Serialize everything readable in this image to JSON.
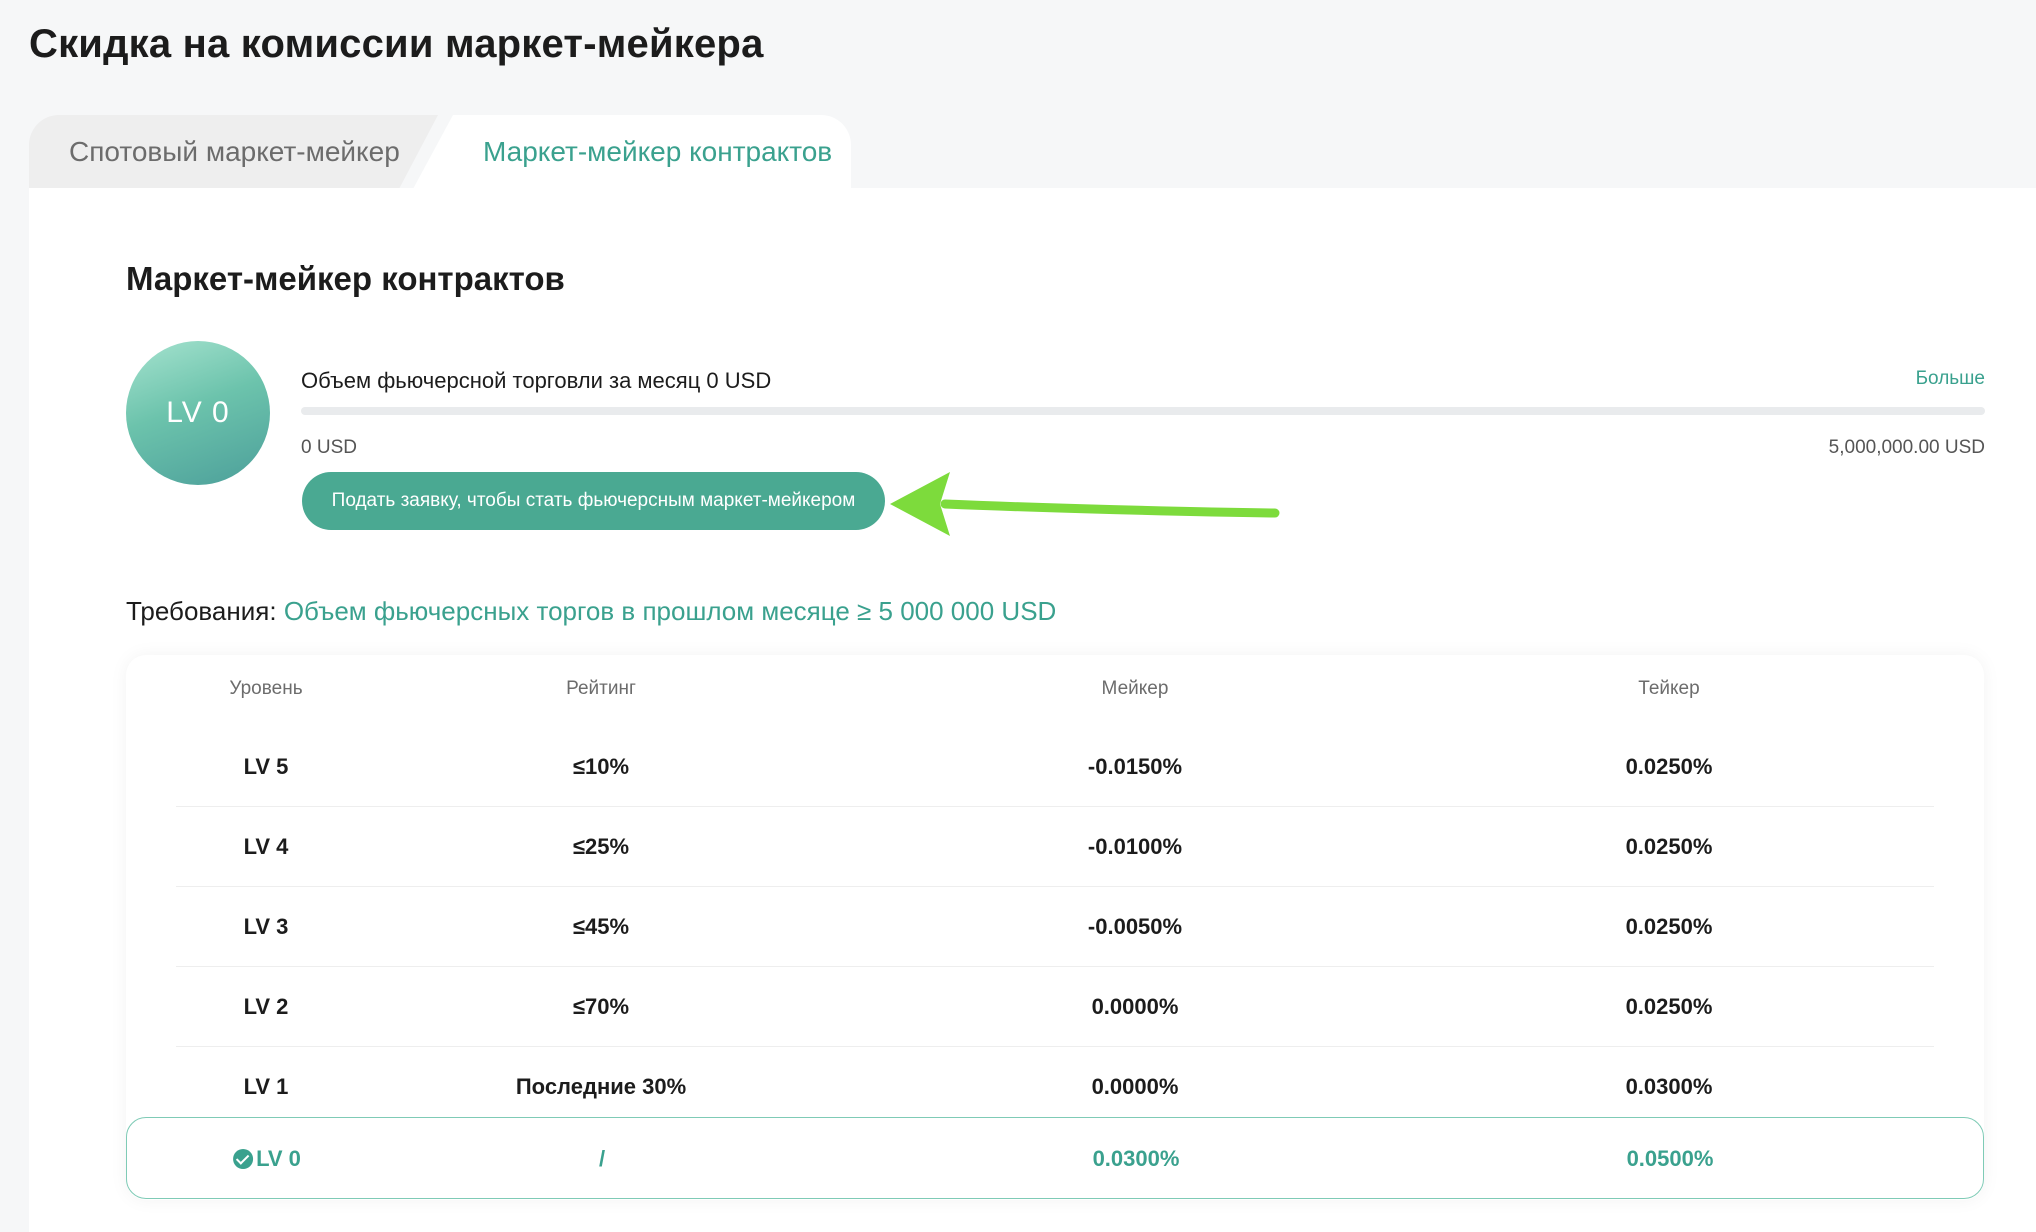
{
  "page": {
    "title": "Скидка на комиссии маркет-мейкера"
  },
  "tabs": [
    {
      "label": "Спотовый маркет-мейкер",
      "active": false
    },
    {
      "label": "Маркет-мейкер контрактов",
      "active": true
    }
  ],
  "section": {
    "title": "Маркет-мейкер контрактов",
    "level_badge": "LV 0",
    "volume_label": "Объем фьючерсной торговли за месяц 0 USD",
    "more_link": "Больше",
    "progress": {
      "value_fraction": 0,
      "min_label": "0 USD",
      "max_label": "5,000,000.00 USD"
    },
    "apply_button": "Подать заявку, чтобы стать фьючерсным маркет-мейкером",
    "requirements_label": "Требования:",
    "requirements_value": "Объем фьючерсных торгов в прошлом месяце ≥ 5 000 000 USD"
  },
  "table": {
    "headers": {
      "level": "Уровень",
      "rating": "Рейтинг",
      "maker": "Мейкер",
      "taker": "Тейкер"
    },
    "rows": [
      {
        "level": "LV 5",
        "rating": "≤10%",
        "maker": "-0.0150%",
        "taker": "0.0250%"
      },
      {
        "level": "LV 4",
        "rating": "≤25%",
        "maker": "-0.0100%",
        "taker": "0.0250%"
      },
      {
        "level": "LV 3",
        "rating": "≤45%",
        "maker": "-0.0050%",
        "taker": "0.0250%"
      },
      {
        "level": "LV 2",
        "rating": "≤70%",
        "maker": "0.0000%",
        "taker": "0.0250%"
      },
      {
        "level": "LV 1",
        "rating": "Последние 30%",
        "maker": "0.0000%",
        "taker": "0.0300%"
      }
    ],
    "current_row": {
      "level": "LV 0",
      "rating": "/",
      "maker": "0.0300%",
      "taker": "0.0500%"
    }
  },
  "colors": {
    "accent": "#3aa18e",
    "button": "#4aa992",
    "annotation_arrow": "#7ddb3c"
  },
  "icons": {
    "current_level": "check-circle-icon",
    "annotation": "arrow-left-icon"
  }
}
